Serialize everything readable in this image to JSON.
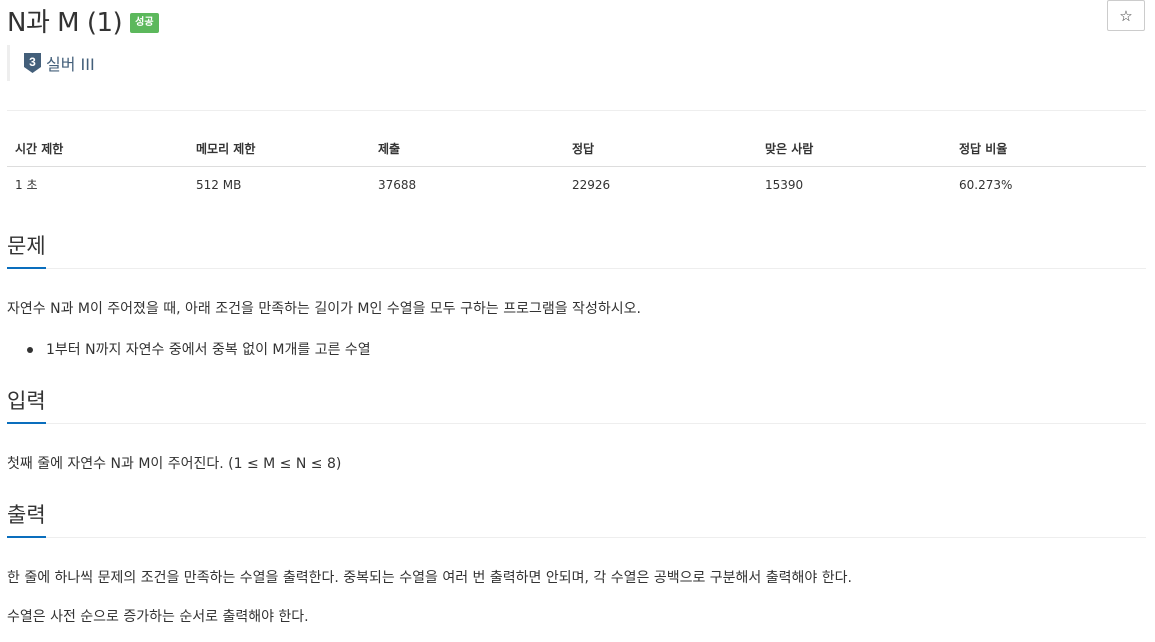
{
  "header": {
    "title": "N과 M (1)",
    "status_badge": "성공",
    "star_icon": "☆",
    "tier": {
      "number": "3",
      "label": "실버 III"
    }
  },
  "stats": {
    "headers": [
      "시간 제한",
      "메모리 제한",
      "제출",
      "정답",
      "맞은 사람",
      "정답 비율"
    ],
    "values": [
      "1 초",
      "512 MB",
      "37688",
      "22926",
      "15390",
      "60.273%"
    ]
  },
  "sections": {
    "problem": {
      "title": "문제",
      "text": "자연수 N과 M이 주어졌을 때, 아래 조건을 만족하는 길이가 M인 수열을 모두 구하는 프로그램을 작성하시오.",
      "bullets": [
        "1부터 N까지 자연수 중에서 중복 없이 M개를 고른 수열"
      ]
    },
    "input": {
      "title": "입력",
      "text": "첫째 줄에 자연수 N과 M이 주어진다. (1 ≤ M ≤ N ≤ 8)"
    },
    "output": {
      "title": "출력",
      "text1": "한 줄에 하나씩 문제의 조건을 만족하는 수열을 출력한다. 중복되는 수열을 여러 번 출력하면 안되며, 각 수열은 공백으로 구분해서 출력해야 한다.",
      "text2": "수열은 사전 순으로 증가하는 순서로 출력해야 한다."
    }
  },
  "colors": {
    "badge_success": "#5cb85c",
    "section_underline": "#0a6ebd",
    "tier_silver": "#435f7a"
  }
}
